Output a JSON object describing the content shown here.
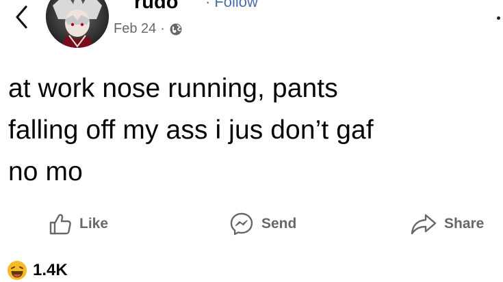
{
  "header": {
    "back_icon": "chevron-left-icon",
    "username": "rudo",
    "follow_separator": "·",
    "follow_label": "Follow",
    "date": "Feb 24",
    "meta_separator": "·",
    "privacy_icon": "globe-icon"
  },
  "post": {
    "lines": [
      "at work nose running, pants",
      "falling off my ass i jus don’t gaf",
      "no mo"
    ]
  },
  "actions": {
    "like_label": "Like",
    "send_label": "Send",
    "share_label": "Share",
    "like_icon": "thumbs-up-icon",
    "send_icon": "messenger-icon",
    "share_icon": "share-arrow-icon"
  },
  "reactions": {
    "emoji_icon": "laughing-emoji-icon",
    "count": "1.4K"
  },
  "colors": {
    "text": "#050505",
    "secondary": "#65676b",
    "link": "#4a6ea9",
    "reaction": "#f7b928"
  }
}
